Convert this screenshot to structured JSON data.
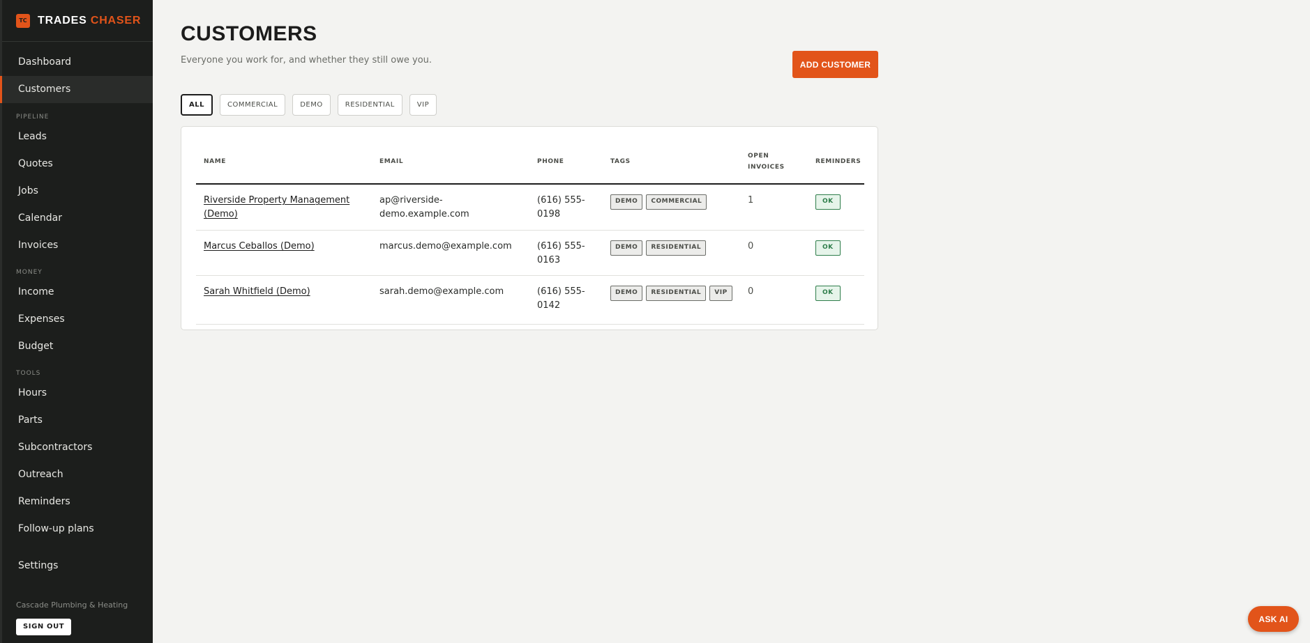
{
  "brand": {
    "logo_text": "TC",
    "name_part1": "TRADES",
    "name_part2": "CHASER"
  },
  "sidebar": {
    "top_items": [
      {
        "label": "Dashboard"
      },
      {
        "label": "Customers"
      }
    ],
    "pipeline_heading": "PIPELINE",
    "pipeline_items": [
      {
        "label": "Leads"
      },
      {
        "label": "Quotes"
      },
      {
        "label": "Jobs"
      },
      {
        "label": "Calendar"
      },
      {
        "label": "Invoices"
      }
    ],
    "money_heading": "MONEY",
    "money_items": [
      {
        "label": "Income"
      },
      {
        "label": "Expenses"
      },
      {
        "label": "Budget"
      }
    ],
    "tools_heading": "TOOLS",
    "tools_items": [
      {
        "label": "Hours"
      },
      {
        "label": "Parts"
      },
      {
        "label": "Subcontractors"
      },
      {
        "label": "Outreach"
      },
      {
        "label": "Reminders"
      },
      {
        "label": "Follow-up plans"
      }
    ],
    "settings_label": "Settings",
    "org_name": "Cascade Plumbing & Heating",
    "signout_label": "SIGN OUT"
  },
  "page": {
    "title": "CUSTOMERS",
    "subtitle": "Everyone you work for, and whether they still owe you.",
    "add_button": "ADD CUSTOMER"
  },
  "filters": [
    {
      "label": "ALL",
      "active": true
    },
    {
      "label": "COMMERCIAL",
      "active": false
    },
    {
      "label": "DEMO",
      "active": false
    },
    {
      "label": "RESIDENTIAL",
      "active": false
    },
    {
      "label": "VIP",
      "active": false
    }
  ],
  "table": {
    "headers": {
      "name": "NAME",
      "email": "EMAIL",
      "phone": "PHONE",
      "tags": "TAGS",
      "open_invoices_line1": "OPEN",
      "open_invoices_line2": "INVOICES",
      "reminders": "REMINDERS"
    },
    "rows": [
      {
        "name": "Riverside Property Management (Demo)",
        "email": "ap@riverside-demo.example.com",
        "phone": "(616) 555-0198",
        "tags": [
          "DEMO",
          "COMMERCIAL"
        ],
        "open_invoices": "1",
        "reminders": "OK"
      },
      {
        "name": "Marcus Ceballos (Demo)",
        "email": "marcus.demo@example.com",
        "phone": "(616) 555-0163",
        "tags": [
          "DEMO",
          "RESIDENTIAL"
        ],
        "open_invoices": "0",
        "reminders": "OK"
      },
      {
        "name": "Sarah Whitfield (Demo)",
        "email": "sarah.demo@example.com",
        "phone": "(616) 555-0142",
        "tags": [
          "DEMO",
          "RESIDENTIAL",
          "VIP"
        ],
        "open_invoices": "0",
        "reminders": "OK"
      }
    ]
  },
  "ask_ai_label": "ASK AI",
  "colors": {
    "accent": "#e2541a",
    "sidebar_bg": "#1c1e1c",
    "ok_green": "#2e7d4a"
  }
}
